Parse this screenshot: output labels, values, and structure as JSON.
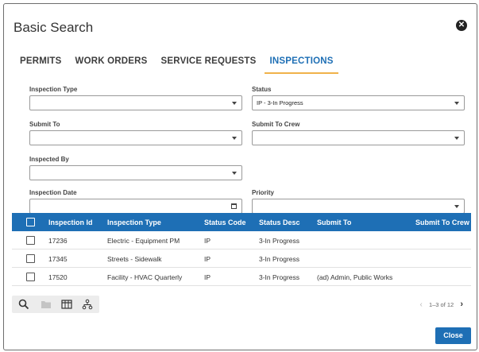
{
  "dialog": {
    "title": "Basic Search",
    "close_symbol": "✕"
  },
  "tabs": [
    {
      "label": "PERMITS",
      "active": false
    },
    {
      "label": "WORK ORDERS",
      "active": false
    },
    {
      "label": "SERVICE REQUESTS",
      "active": false
    },
    {
      "label": "INSPECTIONS",
      "active": true
    }
  ],
  "form": {
    "inspection_type": {
      "label": "Inspection Type",
      "value": ""
    },
    "status": {
      "label": "Status",
      "value": "IP - 3-In Progress"
    },
    "submit_to": {
      "label": "Submit To",
      "value": ""
    },
    "submit_to_crew": {
      "label": "Submit To Crew",
      "value": ""
    },
    "inspected_by": {
      "label": "Inspected By",
      "value": ""
    },
    "inspection_date": {
      "label": "Inspection Date",
      "value": ""
    },
    "priority": {
      "label": "Priority",
      "value": ""
    }
  },
  "grid": {
    "columns": [
      "Inspection Id",
      "Inspection Type",
      "Status Code",
      "Status Desc",
      "Submit To",
      "Submit To Crew"
    ],
    "rows": [
      [
        "17236",
        "Electric - Equipment PM",
        "IP",
        "3-In Progress",
        "",
        ""
      ],
      [
        "17345",
        "Streets - Sidewalk",
        "IP",
        "3-In Progress",
        "",
        ""
      ],
      [
        "17520",
        "Facility - HVAC Quarterly",
        "IP",
        "3-In Progress",
        "(ad) Admin, Public Works",
        ""
      ]
    ]
  },
  "toolbar": {
    "icons": [
      "search-icon",
      "folder-icon",
      "columns-icon",
      "hierarchy-icon"
    ]
  },
  "pager": {
    "text": "1–3 of 12",
    "prev": "‹",
    "next": "›"
  },
  "actions": {
    "close_label": "Close"
  },
  "colors": {
    "accent": "#1e6fb5",
    "tab_underline": "#f0b24a"
  }
}
